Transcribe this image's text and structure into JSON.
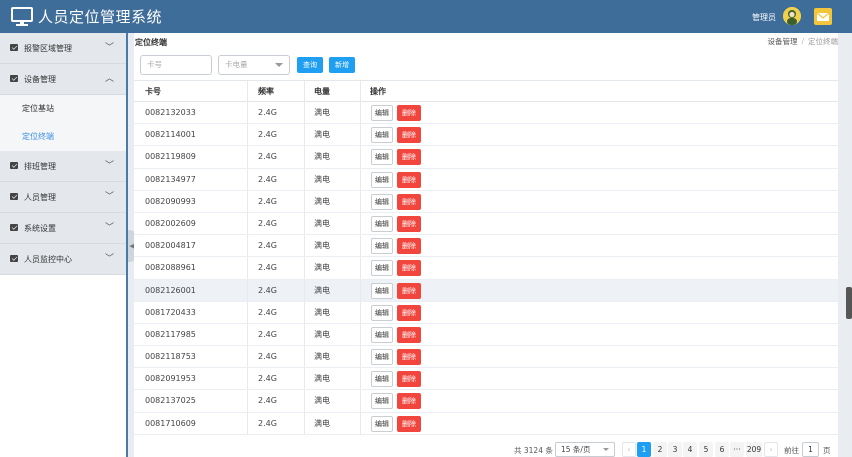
{
  "header": {
    "title": "人员定位管理系统",
    "admin_label": "管理员",
    "icons": [
      "monitor-icon",
      "avatar",
      "mail-icon"
    ]
  },
  "sidebar": {
    "items": [
      {
        "label": "报警区域管理",
        "chevron": "﹀"
      },
      {
        "label": "设备管理",
        "chevron": "︿",
        "expanded": true
      },
      {
        "label": "排班管理",
        "chevron": "﹀"
      },
      {
        "label": "人员管理",
        "chevron": "﹀"
      },
      {
        "label": "系统设置",
        "chevron": "﹀"
      },
      {
        "label": "人员监控中心",
        "chevron": "﹀"
      }
    ],
    "sub_items": [
      {
        "label": "定位基站",
        "active": false
      },
      {
        "label": "定位终端",
        "active": true
      }
    ]
  },
  "main": {
    "page_title": "定位终端",
    "breadcrumb": [
      "设备管理",
      "定位终端"
    ],
    "breadcrumb_sep": "/",
    "filters": {
      "card_placeholder": "卡号",
      "power_placeholder": "卡电量",
      "query_label": "查询",
      "add_label": "新增"
    },
    "table": {
      "headers": [
        "卡号",
        "频率",
        "电量",
        "操作"
      ],
      "edit_label": "编辑",
      "delete_label": "删除",
      "rows": [
        [
          "0082132033",
          "2.4G",
          "满电"
        ],
        [
          "0082114001",
          "2.4G",
          "满电"
        ],
        [
          "0082119809",
          "2.4G",
          "满电"
        ],
        [
          "0082134977",
          "2.4G",
          "满电"
        ],
        [
          "0082090993",
          "2.4G",
          "满电"
        ],
        [
          "0082002609",
          "2.4G",
          "满电"
        ],
        [
          "0082004817",
          "2.4G",
          "满电"
        ],
        [
          "0082088961",
          "2.4G",
          "满电"
        ],
        [
          "0082126001",
          "2.4G",
          "满电"
        ],
        [
          "0081720433",
          "2.4G",
          "满电"
        ],
        [
          "0082117985",
          "2.4G",
          "满电"
        ],
        [
          "0082118753",
          "2.4G",
          "满电"
        ],
        [
          "0082091953",
          "2.4G",
          "满电"
        ],
        [
          "0082137025",
          "2.4G",
          "满电"
        ],
        [
          "0081710609",
          "2.4G",
          "满电"
        ]
      ],
      "highlighted_row": 8
    },
    "pagination": {
      "total_text": "共 3124 条",
      "page_size": "15 条/页",
      "prev": "‹",
      "next": "›",
      "pages": [
        "1",
        "2",
        "3",
        "4",
        "5",
        "6",
        "···",
        "209"
      ],
      "active_page": "1",
      "goto_label": "前往",
      "goto_value": "1",
      "page_unit": "页"
    }
  },
  "colors": {
    "header_bg": "#3f6d99",
    "accent": "#1e9ff2",
    "danger": "#f2453d",
    "active_link": "#3a8ee6"
  }
}
